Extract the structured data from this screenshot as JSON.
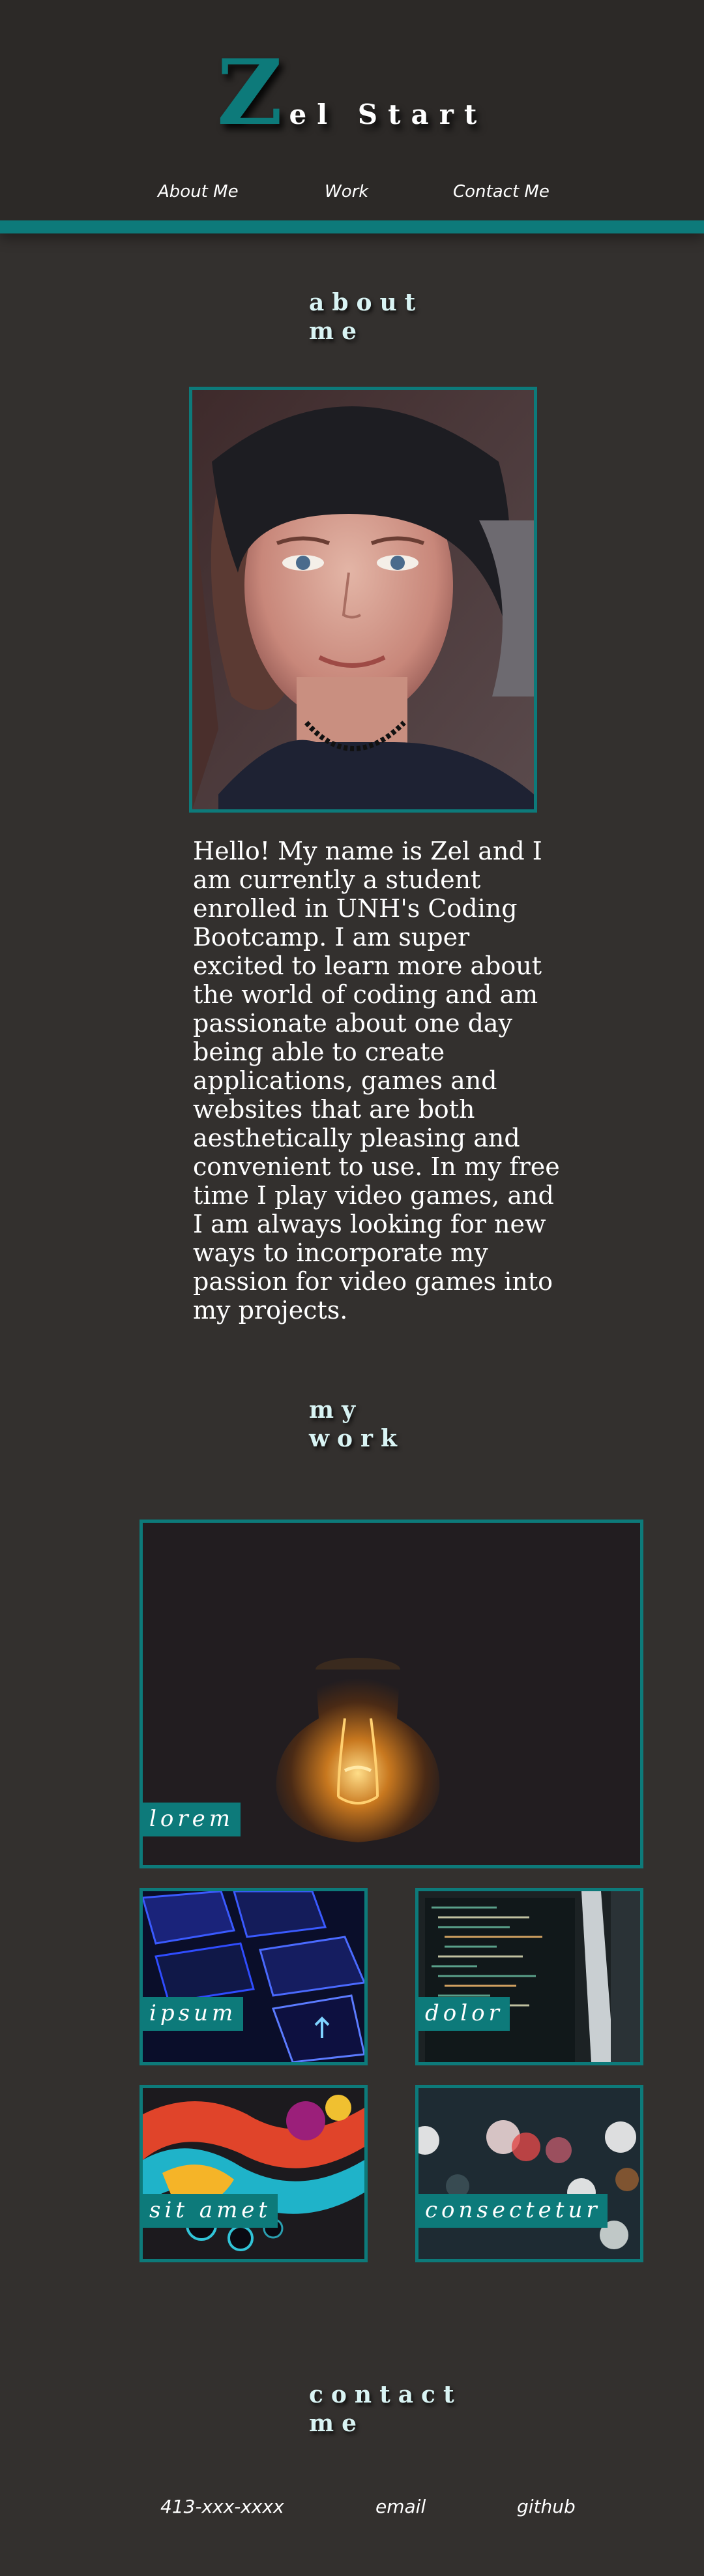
{
  "header": {
    "logo_initial": "Z",
    "logo_rest": "el Start",
    "nav": [
      "About Me",
      "Work",
      "Contact Me"
    ]
  },
  "about": {
    "title_line1": "about",
    "title_line2": "me",
    "bio": "Hello! My name is Zel and I am currently a student enrolled in UNH's Coding Bootcamp. I am super excited to learn more about the world of coding and am passionate about one day being able to create applications, games and websites that are both aesthetically pleasing and convenient to use. In my free time I play video games, and I am always looking for new ways to incorporate my passion for video games into my projects."
  },
  "work": {
    "title_line1": "my",
    "title_line2": "work",
    "projects": [
      "lorem",
      "ipsum",
      "dolor",
      "sit amet",
      "consectetur"
    ]
  },
  "contact": {
    "title_line1": "contact",
    "title_line2": "me",
    "links": [
      "413-xxx-xxxx",
      "email",
      "github"
    ]
  },
  "colors": {
    "accent": "#0d7a7a",
    "background": "#33302e",
    "header_background": "#2c2927",
    "heading_text": "#d9f4f4"
  }
}
